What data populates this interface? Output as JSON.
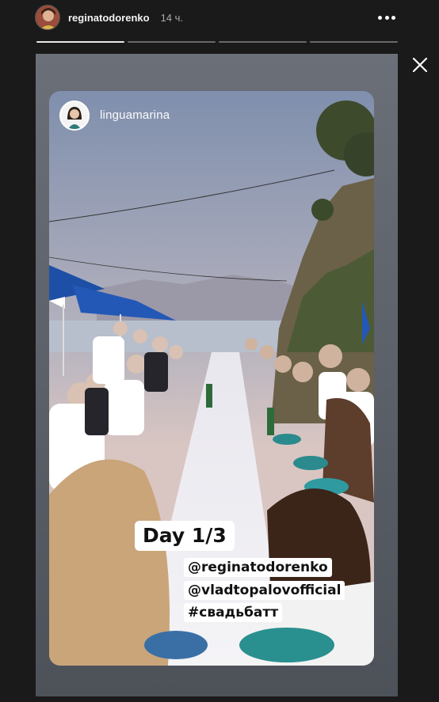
{
  "story": {
    "username": "reginatodorenko",
    "time_ago": "14 ч.",
    "progress_segments": 4,
    "progress_active_index": 0,
    "icons": {
      "more": "more-horizontal-icon",
      "close": "close-icon"
    }
  },
  "shared_post": {
    "author": "linguamarina",
    "sticker_text": "Day 1/3",
    "tags": [
      "@reginatodorenko",
      "@vladtopalovofficial",
      "#свадьбатт"
    ]
  },
  "colors": {
    "background": "#1a1a1a",
    "frame": "#5c6068",
    "sticker_bg": "#ffffff"
  }
}
